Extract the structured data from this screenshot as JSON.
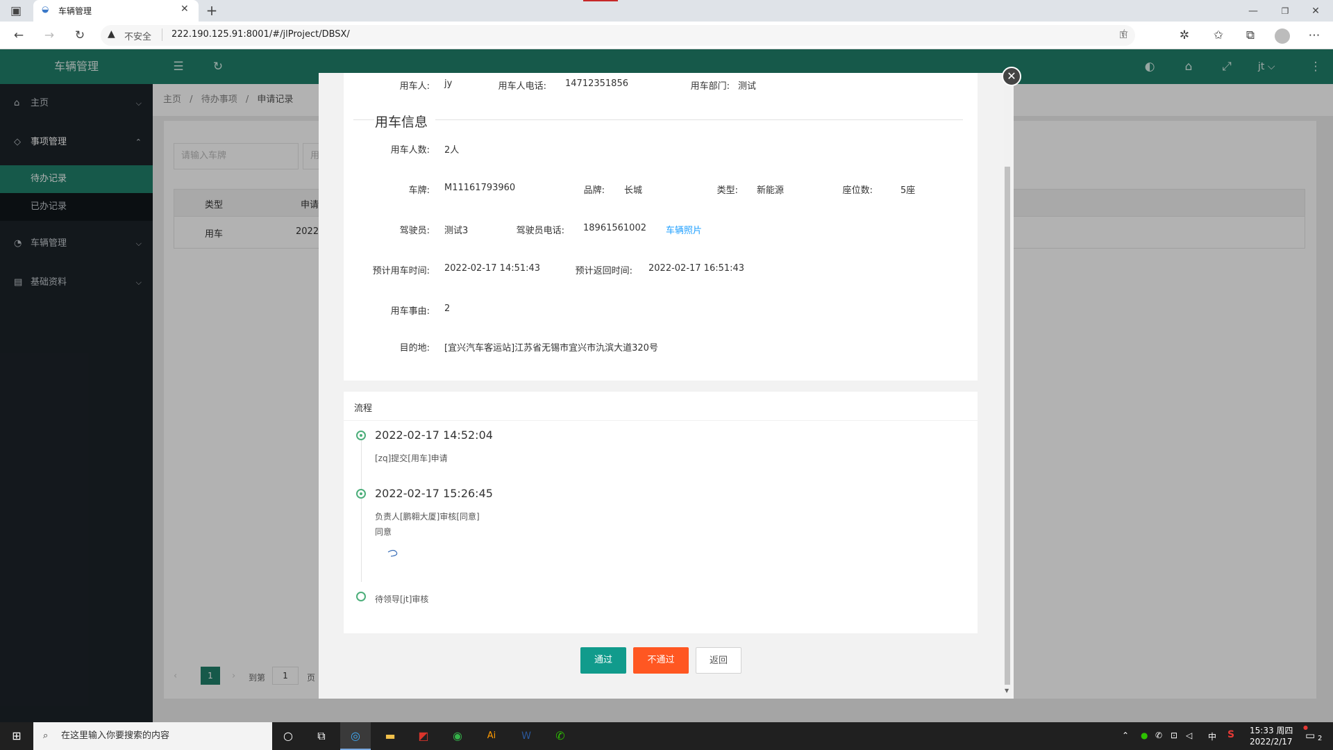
{
  "browser": {
    "tab_title": "车辆管理",
    "insecure_label": "不安全",
    "url": "222.190.125.91:8001/#/jlProject/DBSX/"
  },
  "app": {
    "title": "车辆管理",
    "user": "jt"
  },
  "sidebar": {
    "items": [
      {
        "label": "主页"
      },
      {
        "label": "事项管理"
      },
      {
        "label": "车辆管理"
      },
      {
        "label": "基础资料"
      }
    ],
    "subitems": [
      {
        "label": "待办记录"
      },
      {
        "label": "已办记录"
      }
    ]
  },
  "breadcrumb": [
    "主页",
    "/",
    "待办事项",
    "/",
    "申请记录"
  ],
  "background_page": {
    "search_placeholder": "请输入车牌",
    "search2_placeholder": "用",
    "table_headers": [
      "类型",
      "申请"
    ],
    "row": [
      "用车",
      "2022-"
    ],
    "pagination": {
      "page": "1",
      "goto_label": "到第",
      "goto_value": "1",
      "page_label": "页"
    }
  },
  "modal": {
    "applicant": {
      "label": "用车人:",
      "value": "jy"
    },
    "phone": {
      "label": "用车人电话:",
      "value": "14712351856"
    },
    "department": {
      "label": "用车部门:",
      "value": "测试"
    },
    "section_title": "用车信息",
    "passengers": {
      "label": "用车人数:",
      "value": "2人"
    },
    "plate": {
      "label": "车牌:",
      "value": "M11161793960"
    },
    "brand": {
      "label": "品牌:",
      "value": "长城"
    },
    "type": {
      "label": "类型:",
      "value": "新能源"
    },
    "seats": {
      "label": "座位数:",
      "value": "5座"
    },
    "driver": {
      "label": "驾驶员:",
      "value": "测试3"
    },
    "driver_phone": {
      "label": "驾驶员电话:",
      "value": "18961561002"
    },
    "car_photo_link": "车辆照片",
    "start_time": {
      "label": "预计用车时间:",
      "value": "2022-02-17 14:51:43"
    },
    "return_time": {
      "label": "预计返回时间:",
      "value": "2022-02-17 16:51:43"
    },
    "reason": {
      "label": "用车事由:",
      "value": "2"
    },
    "destination": {
      "label": "目的地:",
      "value": "[宜兴汽车客运站]江苏省无锡市宜兴市氿滨大道320号"
    },
    "process_title": "流程",
    "timeline": [
      {
        "time": "2022-02-17 14:52:04",
        "text": "[zq]提交[用车]申请"
      },
      {
        "time": "2022-02-17 15:26:45",
        "text": "负责人[鹏翱大厦]审核[同意]",
        "note": "同意"
      },
      {
        "text": "待领导[jt]审核"
      }
    ],
    "buttons": {
      "approve": "通过",
      "reject": "不通过",
      "back": "返回"
    }
  },
  "taskbar": {
    "search_placeholder": "在这里输入你要搜索的内容",
    "time": "15:33 周四",
    "date": "2022/2/17",
    "ime": "中",
    "notification_count": "2"
  },
  "colors": {
    "brand": "#20806b",
    "reject": "#ff5722",
    "link": "#1e9fff",
    "timeline": "#4cae7a"
  }
}
